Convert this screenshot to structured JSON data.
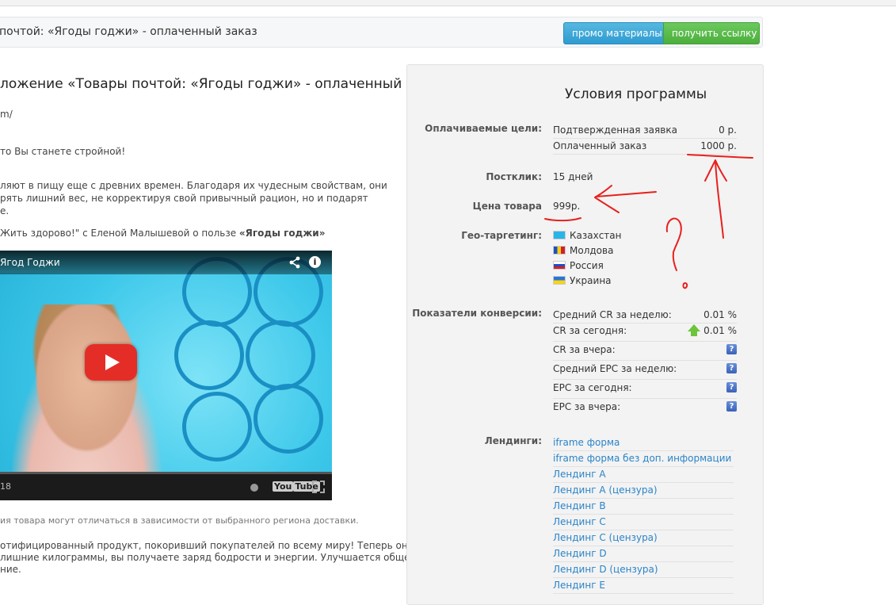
{
  "header": {
    "title": "почтой: «Ягоды годжи» - оплаченный заказ",
    "promo_button": "промо материалы",
    "link_button": "получить ссылку"
  },
  "left": {
    "heading": "ложение «Товары почтой: «Ягоды годжи» - оплаченный",
    "url_fragment": "m/",
    "line1": "то Вы станете стройной!",
    "para1": [
      "ляют в пищу еще с древних времен. Благодаря их чудесным свойствам, они",
      "рять лишний вес, не корректируя свой привычный рацион, но и подарят",
      "е."
    ],
    "video_caption_prefix": "Жить здорово!\" с Еленой Малышевой о пользе ",
    "video_caption_bold": "«Ягоды годжи»",
    "video_title": "Ягод Годжи",
    "video_time": "18",
    "youtube_label": "You",
    "youtube_tube": "Tube",
    "note": "ия товара могут отличаться в зависимости от выбранного региона доставки.",
    "para2": [
      "отифицированный продукт, покоривший покупателей по всему миру! Теперь он",
      "лишние килограммы, вы получаете заряд бодрости и энергии. Улучшается общее",
      "ние."
    ]
  },
  "panel": {
    "title": "Условия программы",
    "goals_label": "Оплачиваемые цели:",
    "goals": [
      {
        "name": "Подтвержденная заявка",
        "value": "0 р."
      },
      {
        "name": "Оплаченный заказ",
        "value": "1000 р."
      }
    ],
    "postclick_label": "Постклик:",
    "postclick_value": "15 дней",
    "price_label": "Цена товара",
    "price_value": "999р.",
    "geo_label": "Гео-таргетинг:",
    "geo": [
      "Казахстан",
      "Молдова",
      "Россия",
      "Украина"
    ],
    "conv_label": "Показатели конверсии:",
    "conversion": [
      {
        "name": "Средний CR за неделю:",
        "value": "0.01 %",
        "icon": ""
      },
      {
        "name": "CR за сегодня:",
        "value": "0.01 %",
        "icon": "up-arrow-icon"
      },
      {
        "name": "CR за вчера:",
        "value": "",
        "icon": "help-icon"
      },
      {
        "name": "Средний EPC за неделю:",
        "value": "",
        "icon": "help-icon"
      },
      {
        "name": "EPC за сегодня:",
        "value": "",
        "icon": "help-icon"
      },
      {
        "name": "EPC за вчера:",
        "value": "",
        "icon": "help-icon"
      }
    ],
    "help_glyph": "?",
    "landings_label": "Лендинги:",
    "landings": [
      "iframe форма",
      "iframe форма без доп. информации",
      "Лендинг A",
      "Лендинг A (цензура)",
      "Лендинг B",
      "Лендинг C",
      "Лендинг C (цензура)",
      "Лендинг D",
      "Лендинг D (цензура)",
      "Лендинг E"
    ]
  },
  "colors": {
    "promo_button": "#2f9bd0",
    "link_button": "#4cae3d",
    "link_text": "#2a84c8",
    "annotation": "#e8201c"
  }
}
